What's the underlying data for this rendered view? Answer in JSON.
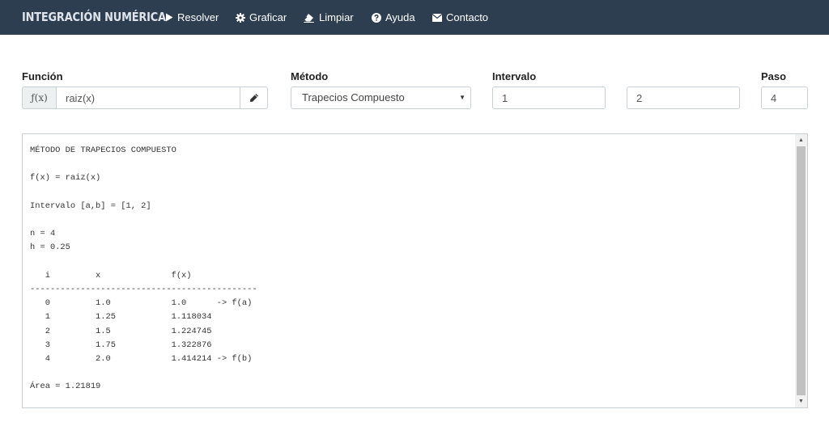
{
  "navbar": {
    "brand": "INTEGRACIÓN NUMÉRICA",
    "items": [
      {
        "label": "Resolver",
        "icon": "play-icon"
      },
      {
        "label": "Graficar",
        "icon": "gear-icon"
      },
      {
        "label": "Limpiar",
        "icon": "eraser-icon"
      },
      {
        "label": "Ayuda",
        "icon": "question-circle-icon"
      },
      {
        "label": "Contacto",
        "icon": "envelope-icon"
      }
    ]
  },
  "form": {
    "funcion_label": "Función",
    "funcion_addon": "ƒ(x)",
    "funcion_value": "raiz(x)",
    "metodo_label": "Método",
    "metodo_value": "Trapecios Compuesto",
    "intervalo_label": "Intervalo",
    "intervalo_a": "1",
    "intervalo_b": "2",
    "paso_label": "Paso",
    "paso_value": "4"
  },
  "output": {
    "text": "MÉTODO DE TRAPECIOS COMPUESTO\n\nf(x) = raiz(x)\n\nIntervalo [a,b] = [1, 2]\n\nn = 4\nh = 0.25\n\n   i         x              f(x)\n---------------------------------------------\n   0         1.0            1.0      -> f(a)\n   1         1.25           1.118034\n   2         1.5            1.224745\n   3         1.75           1.322876\n   4         2.0            1.414214 -> f(b)\n\nÁrea = 1.21819"
  }
}
